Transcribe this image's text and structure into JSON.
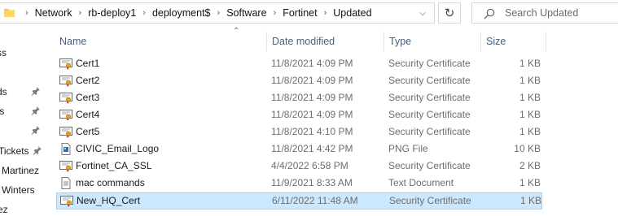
{
  "address_bar": {
    "breadcrumbs": [
      "Network",
      "rb-deploy1",
      "deployment$",
      "Software",
      "Fortinet",
      "Updated"
    ]
  },
  "search": {
    "placeholder": "Search Updated"
  },
  "nav_pane": {
    "items": [
      {
        "label": "ss",
        "pinned": false
      },
      {
        "label": "ds",
        "pinned": true
      },
      {
        "label": "ts",
        "pinned": true
      },
      {
        "label": "",
        "pinned": true
      },
      {
        "label": "Tickets",
        "pinned": true
      },
      {
        "label": "Martinez",
        "pinned": false
      },
      {
        "label": "Winters",
        "pinned": false
      },
      {
        "label": "ez",
        "pinned": false
      }
    ]
  },
  "columns": {
    "name": "Name",
    "date_modified": "Date modified",
    "type": "Type",
    "size": "Size"
  },
  "files": [
    {
      "name": "Cert1",
      "date": "11/8/2021 4:09 PM",
      "type": "Security Certificate",
      "size": "1 KB",
      "icon": "certificate-icon",
      "selected": false
    },
    {
      "name": "Cert2",
      "date": "11/8/2021 4:09 PM",
      "type": "Security Certificate",
      "size": "1 KB",
      "icon": "certificate-icon",
      "selected": false
    },
    {
      "name": "Cert3",
      "date": "11/8/2021 4:09 PM",
      "type": "Security Certificate",
      "size": "1 KB",
      "icon": "certificate-icon",
      "selected": false
    },
    {
      "name": "Cert4",
      "date": "11/8/2021 4:09 PM",
      "type": "Security Certificate",
      "size": "1 KB",
      "icon": "certificate-icon",
      "selected": false
    },
    {
      "name": "Cert5",
      "date": "11/8/2021 4:10 PM",
      "type": "Security Certificate",
      "size": "1 KB",
      "icon": "certificate-icon",
      "selected": false
    },
    {
      "name": "CIVIC_Email_Logo",
      "date": "11/8/2021 4:42 PM",
      "type": "PNG File",
      "size": "10 KB",
      "icon": "image-file-icon",
      "selected": false
    },
    {
      "name": "Fortinet_CA_SSL",
      "date": "4/4/2022 6:58 PM",
      "type": "Security Certificate",
      "size": "2 KB",
      "icon": "certificate-icon",
      "selected": false
    },
    {
      "name": "mac commands",
      "date": "11/9/2021 8:33 AM",
      "type": "Text Document",
      "size": "1 KB",
      "icon": "text-file-icon",
      "selected": false
    },
    {
      "name": "New_HQ_Cert",
      "date": "6/11/2022 11:48 AM",
      "type": "Security Certificate",
      "size": "1 KB",
      "icon": "certificate-icon",
      "selected": true
    }
  ],
  "colors": {
    "selection_bg": "#cce8ff",
    "selection_border": "#99d1ff",
    "header_text": "#4c607a",
    "folder": "#f4c542"
  }
}
